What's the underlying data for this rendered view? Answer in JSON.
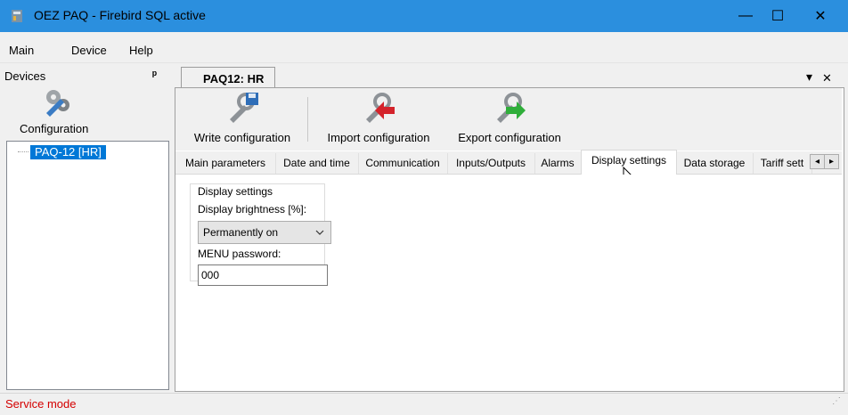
{
  "window": {
    "title": "OEZ PAQ - Firebird SQL active",
    "minimize": "—",
    "maximize": "☐",
    "close": "✕"
  },
  "menu": [
    {
      "label": "Main"
    },
    {
      "label": "Device"
    },
    {
      "label": "Help"
    }
  ],
  "devices": {
    "header": "Devices",
    "pin": "ᵖ",
    "config_label": "Configuration",
    "tree_item": "PAQ-12 [HR]"
  },
  "document": {
    "tab_label": "PAQ12: HR",
    "tab_menu": "▾",
    "tab_close": "✕",
    "toolbar": {
      "write": "Write configuration",
      "import": "Import configuration",
      "export": "Export configuration"
    },
    "tabs": [
      {
        "label": "Main parameters"
      },
      {
        "label": "Date and time"
      },
      {
        "label": "Communication"
      },
      {
        "label": "Inputs/Outputs"
      },
      {
        "label": "Alarms"
      },
      {
        "label": "Display settings"
      },
      {
        "label": "Data storage"
      },
      {
        "label": "Tariff sett"
      }
    ],
    "tab_scroll_left": "◂",
    "tab_scroll_right": "▸",
    "display": {
      "group_title": "Display settings",
      "brightness_label": "Display brightness [%]:",
      "brightness_value": "Permanently on",
      "password_label": "MENU password:",
      "password_value": "000"
    }
  },
  "status": {
    "text": "Service mode",
    "text_color": "#d40000"
  },
  "colors": {
    "titlebar": "#2b8fde",
    "selection": "#0078d7"
  }
}
